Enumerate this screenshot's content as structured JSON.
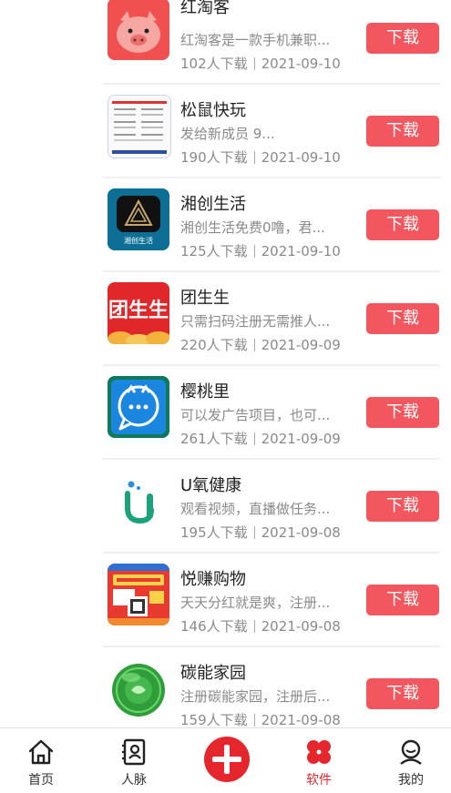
{
  "apps": [
    {
      "name": "红淘客",
      "desc": "红淘客是一款手机兼职...",
      "downloads": "102人下载",
      "date": "2021-09-10",
      "button": "下载",
      "icon": "pig-mascot-icon"
    },
    {
      "name": "松鼠快玩",
      "desc": "发给新成员 9...",
      "downloads": "190人下载",
      "date": "2021-09-10",
      "button": "下载",
      "icon": "document-screenshot-icon"
    },
    {
      "name": "湘创生活",
      "desc": "湘创生活免费0噜，君...",
      "downloads": "125人下载",
      "date": "2021-09-10",
      "button": "下载",
      "icon": "xiangchuang-logo-icon",
      "icon_label": "湘创生活"
    },
    {
      "name": "团生生",
      "desc": "只需扫码注册无需推人...",
      "downloads": "220人下载",
      "date": "2021-09-09",
      "button": "下载",
      "icon": "tuanshengsheng-logo-icon",
      "icon_label": "团生生"
    },
    {
      "name": "樱桃里",
      "desc": "可以发广告项目，也可...",
      "downloads": "261人下载",
      "date": "2021-09-09",
      "button": "下载",
      "icon": "chat-bubble-icon"
    },
    {
      "name": "U氧健康",
      "desc": "观看视频，直播做任务...",
      "downloads": "195人下载",
      "date": "2021-09-08",
      "button": "下载",
      "icon": "u-logo-icon"
    },
    {
      "name": "悦赚购物",
      "desc": "天天分红就是爽，注册...",
      "downloads": "146人下载",
      "date": "2021-09-08",
      "button": "下载",
      "icon": "shopping-poster-icon"
    },
    {
      "name": "碳能家园",
      "desc": "注册碳能家园，注册后...",
      "downloads": "159人下载",
      "date": "2021-09-08",
      "button": "下载",
      "icon": "green-coin-icon"
    }
  ],
  "tabbar": {
    "home": "首页",
    "contacts": "人脉",
    "software": "软件",
    "mine": "我的"
  },
  "colors": {
    "accent": "#e5262d",
    "button": "#f2565e"
  }
}
